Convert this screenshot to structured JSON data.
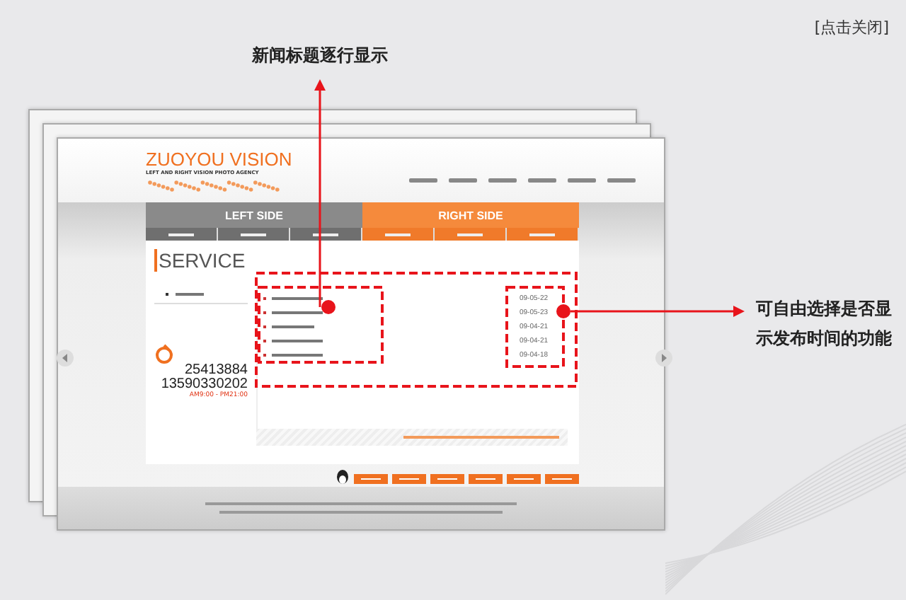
{
  "close_label": "[点击关闭]",
  "annotations": [
    {
      "text": "新闻标题逐行显示"
    },
    {
      "text": "可自由选择是否显示发布时间的功能"
    }
  ],
  "site": {
    "logo_title": "ZUOYOU VISION",
    "logo_subtitle": "LEFT AND RIGHT VISION PHOTO AGENCY",
    "nav_left": "LEFT SIDE",
    "nav_right": "RIGHT SIDE",
    "section_title": "SERVICE",
    "phone": "25413884",
    "mobile": "13590330202",
    "hours": "AM9:00 - PM21:00",
    "news": [
      {
        "date": "09-05-22"
      },
      {
        "date": "09-05-23"
      },
      {
        "date": "09-04-21"
      },
      {
        "date": "09-04-21"
      },
      {
        "date": "09-04-18"
      }
    ]
  }
}
